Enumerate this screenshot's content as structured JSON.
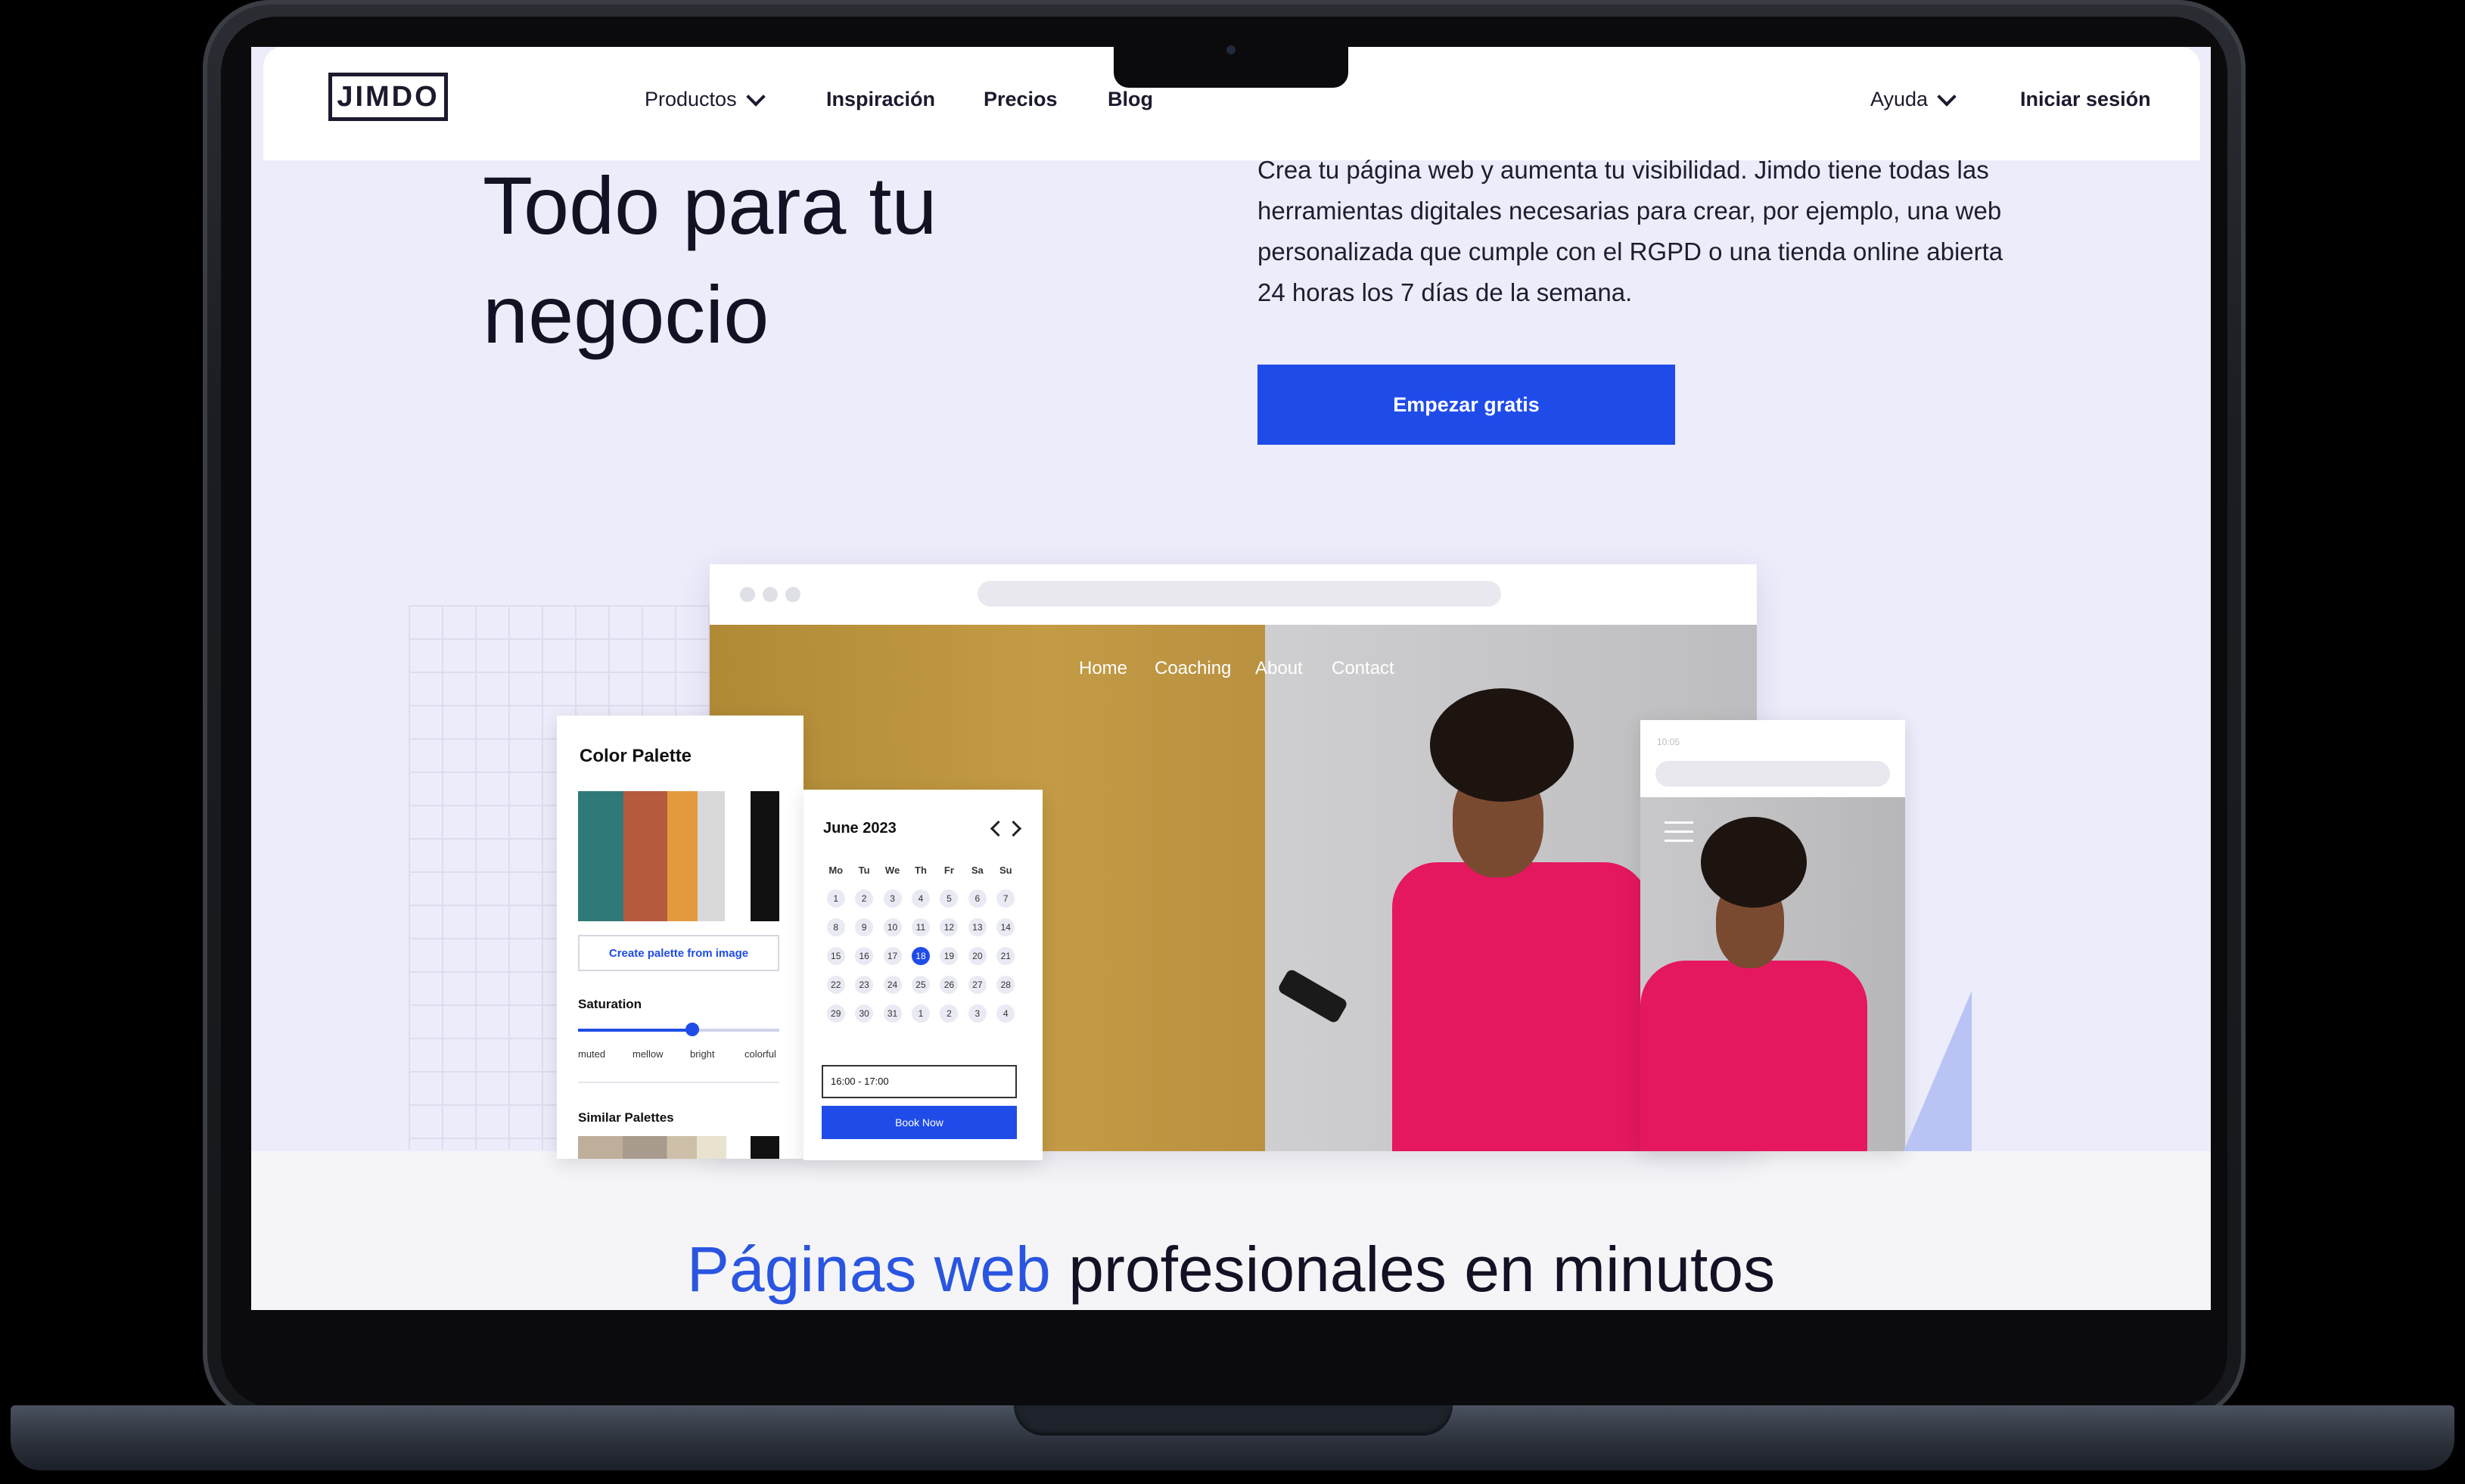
{
  "header": {
    "logo": "JIMDO",
    "nav": [
      {
        "label": "Productos",
        "dropdown": true
      },
      {
        "label": "Inspiración"
      },
      {
        "label": "Precios"
      },
      {
        "label": "Blog"
      }
    ],
    "help": "Ayuda",
    "login": "Iniciar sesión"
  },
  "hero": {
    "title_line1": "Todo para tu",
    "title_line2": "negocio",
    "text": "Crea tu página web y aumenta tu visibilidad. Jimdo tiene todas las herramientas digitales necesarias para crear, por ejemplo, una web personalizada que cumple con el RGPD o una tienda online abierta 24 horas los 7 días de la semana.",
    "cta": "Empezar gratis"
  },
  "mock_site": {
    "nav": [
      "Home",
      "Coaching",
      "About",
      "Contact"
    ]
  },
  "palette_card": {
    "title": "Color Palette",
    "swatches": [
      "#2f7a78",
      "#b65a3e",
      "#e39a3f",
      "#d9d9d9",
      "#ffffff",
      "#111111"
    ],
    "button": "Create palette from image",
    "saturation_label": "Saturation",
    "saturation_value": 0.57,
    "scale": [
      "muted",
      "mellow",
      "bright",
      "colorful"
    ],
    "similar": "Similar Palettes"
  },
  "calendar_card": {
    "month": "June 2023",
    "weekdays": [
      "Mo",
      "Tu",
      "We",
      "Th",
      "Fr",
      "Sa",
      "Su"
    ],
    "days": [
      "1",
      "2",
      "3",
      "4",
      "5",
      "6",
      "7",
      "8",
      "9",
      "10",
      "11",
      "12",
      "13",
      "14",
      "15",
      "16",
      "17",
      "18",
      "19",
      "20",
      "21",
      "22",
      "23",
      "24",
      "25",
      "26",
      "27",
      "28",
      "29",
      "30",
      "31",
      "1",
      "2",
      "3",
      "4"
    ],
    "selected_day": "18",
    "time": "16:00 - 17:00",
    "book": "Book Now"
  },
  "phone": {
    "time": "10:05"
  },
  "section": {
    "title_highlight": "Páginas web",
    "title_rest": " profesionales en minutos"
  },
  "colors": {
    "accent": "#1f4ce8",
    "hero_bg": "#ececfb",
    "shirt": "#e5175f"
  }
}
